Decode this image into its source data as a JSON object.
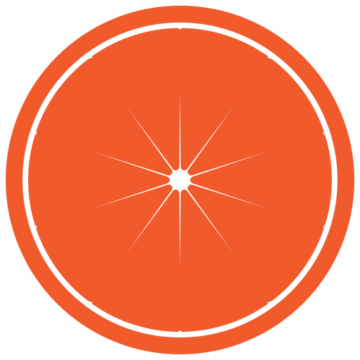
{
  "icon": {
    "name": "orange-slice-icon",
    "segment_count": 10,
    "colors": {
      "fruit": "#F15A2B",
      "pith": "#FFFFFF",
      "background": "#FFFFFF"
    }
  }
}
